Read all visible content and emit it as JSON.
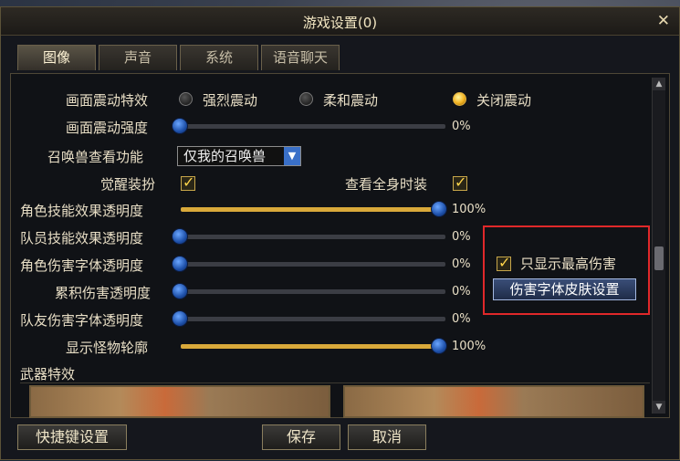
{
  "window": {
    "title": "游戏设置(0)",
    "close_glyph": "✕"
  },
  "tabs": [
    "图像",
    "声音",
    "系统",
    "语音聊天"
  ],
  "settings": {
    "shake_effect": {
      "label": "画面震动特效",
      "options": [
        "强烈震动",
        "柔和震动",
        "关闭震动"
      ],
      "selected": "关闭震动"
    },
    "shake_strength": {
      "label": "画面震动强度",
      "value": 0,
      "value_text": "0%"
    },
    "summon_view": {
      "label": "召唤兽查看功能",
      "value": "仅我的召唤兽"
    },
    "awaken_outfit": {
      "label": "觉醒装扮",
      "checked": true
    },
    "view_full_fashion": {
      "label": "查看全身时装",
      "checked": true
    },
    "sliders": [
      {
        "label": "角色技能效果透明度",
        "value": 100,
        "value_text": "100%"
      },
      {
        "label": "队员技能效果透明度",
        "value": 0,
        "value_text": "0%"
      },
      {
        "label": "角色伤害字体透明度",
        "value": 0,
        "value_text": "0%"
      },
      {
        "label": "累积伤害透明度",
        "value": 0,
        "value_text": "0%"
      },
      {
        "label": "队友伤害字体透明度",
        "value": 0,
        "value_text": "0%"
      },
      {
        "label": "显示怪物轮廓",
        "value": 100,
        "value_text": "100%"
      }
    ],
    "max_damage_only": {
      "label": "只显示最高伤害",
      "checked": true
    },
    "damage_skin_button": "伤害字体皮肤设置"
  },
  "weapon_section": {
    "title": "武器特效"
  },
  "footer": {
    "shortcut": "快捷键设置",
    "save": "保存",
    "cancel": "取消"
  },
  "colors": {
    "accent_gold": "#d9a93a",
    "knob_blue": "#1d4fa8",
    "highlight_red": "#e0282a"
  }
}
